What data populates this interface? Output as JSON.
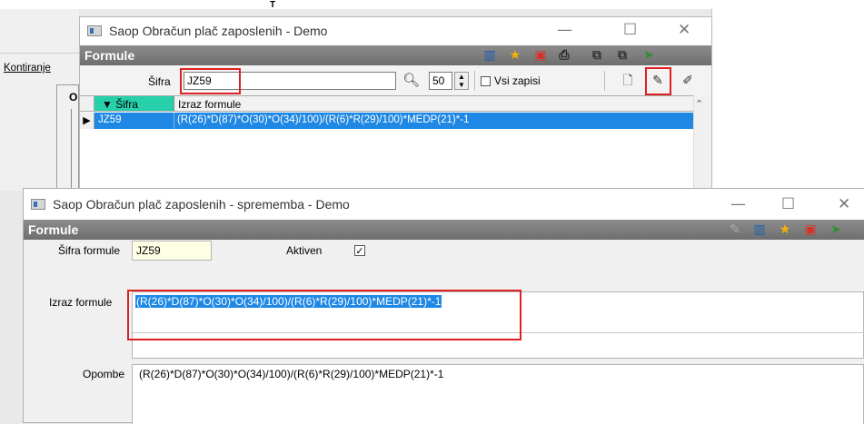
{
  "background": {
    "tab_label": "Kontiranje",
    "tab_separator": "|",
    "group_letter": "O",
    "mark": "T"
  },
  "main_window": {
    "title": "Saop Obračun plač zaposlenih - Demo",
    "controls": {
      "minimize": "—",
      "maximize": "☐",
      "close": "✕"
    },
    "section_title": "Formule",
    "toolbar_icons": [
      "columns-icon",
      "star-icon",
      "delete-icon",
      "print-icon",
      "copy-icon",
      "paste-icon",
      "exit-icon"
    ],
    "search": {
      "label": "Šifra",
      "value": "JZ59",
      "count": "50",
      "show_all_label": "Vsi zapisi",
      "show_all_checked": false
    },
    "action_icons": [
      "new-icon",
      "edit-icon",
      "edit-multi-icon"
    ],
    "grid": {
      "columns": [
        "▼ Šifra",
        "Izraz formule"
      ],
      "rows": [
        {
          "sifra": "JZ59",
          "izraz": "(R(26)*D(87)*O(30)*O(34)/100)/(R(6)*R(29)/100)*MEDP(21)*-1",
          "selected": true
        }
      ]
    }
  },
  "edit_window": {
    "title": "Saop Obračun plač zaposlenih - sprememba - Demo",
    "controls": {
      "minimize": "—",
      "maximize": "☐",
      "close": "✕"
    },
    "section_title": "Formule",
    "toolbar_icons": [
      "edit-icon",
      "columns-icon",
      "star-icon",
      "delete-icon",
      "exit-icon"
    ],
    "form": {
      "sifra_label": "Šifra formule",
      "sifra_value": "JZ59",
      "aktiven_label": "Aktiven",
      "aktiven_checked": true,
      "izraz_label": "Izraz formule",
      "izraz_value": "(R(26)*D(87)*O(30)*O(34)/100)/(R(6)*R(29)/100)*MEDP(21)*-1",
      "opombe_label": "Opombe",
      "opombe_value": "(R(26)*D(87)*O(30)*O(34)/100)/(R(6)*R(29)/100)*MEDP(21)*-1"
    }
  },
  "colors": {
    "selection": "#1f88e4",
    "header_bar": "#7a7a7a",
    "sort_column": "#26d0aa",
    "highlight_box": "#e02020"
  }
}
